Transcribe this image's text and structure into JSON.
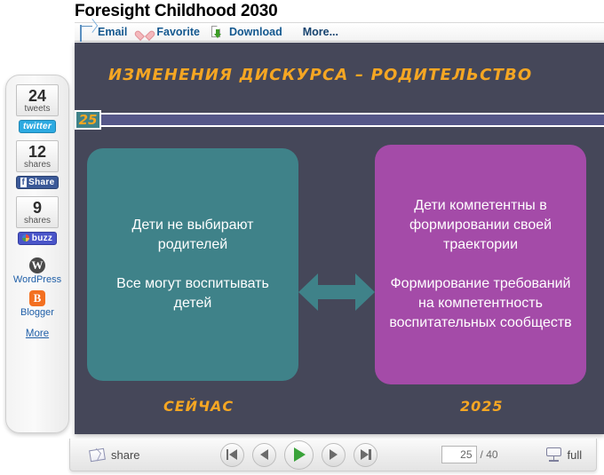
{
  "document": {
    "title": "Foresight Childhood 2030"
  },
  "toolbar": {
    "items": [
      {
        "label": "Email",
        "icon": "envelope-icon"
      },
      {
        "label": "Favorite",
        "icon": "heart-icon"
      },
      {
        "label": "Download",
        "icon": "download-icon"
      },
      {
        "label": "More...",
        "icon": "none"
      }
    ]
  },
  "social_rail": {
    "blocks": [
      {
        "count": "24",
        "unit": "tweets",
        "network": "Twitter",
        "badge": "twitter",
        "badge_label": "twitter"
      },
      {
        "count": "12",
        "unit": "shares",
        "network": "Facebook",
        "badge": "facebook",
        "badge_label": "Share"
      },
      {
        "count": "9",
        "unit": "shares",
        "network": "Buzz",
        "badge": "buzz",
        "badge_label": "buzz"
      }
    ],
    "links": [
      {
        "label": "WordPress",
        "glyph": "W",
        "icon": "wordpress-icon"
      },
      {
        "label": "Blogger",
        "glyph": "B",
        "icon": "blogger-icon"
      }
    ],
    "more_label": "More"
  },
  "slide": {
    "title": "ИЗМЕНЕНИЯ ДИСКУРСА – РОДИТЕЛЬСТВО",
    "marker_number": "25",
    "background_color": "#454759",
    "accent_color": "#f5a623",
    "progress_bar_color": "#555788",
    "left_box": {
      "color": "#3f8289",
      "lines": [
        "Дети не выбирают родителей",
        "Все могут воспитывать детей"
      ],
      "era_label": "СЕЙЧАС"
    },
    "right_box": {
      "color": "#a44ba8",
      "lines": [
        "Дети компетентны в формировании своей траектории",
        "Формирование требований на компетентность воспитательных сообществ"
      ],
      "era_label": "2025"
    },
    "connector": "double-headed-arrow"
  },
  "player": {
    "share_label": "share",
    "buttons": [
      {
        "name": "first-slide",
        "icon": "skip-back-icon"
      },
      {
        "name": "previous-slide",
        "icon": "previous-icon"
      },
      {
        "name": "play",
        "icon": "play-icon"
      },
      {
        "name": "next-slide",
        "icon": "next-icon"
      },
      {
        "name": "last-slide",
        "icon": "skip-forward-icon"
      }
    ],
    "current_page": "25",
    "total_pages": "/ 40",
    "fullscreen_label": "full"
  }
}
